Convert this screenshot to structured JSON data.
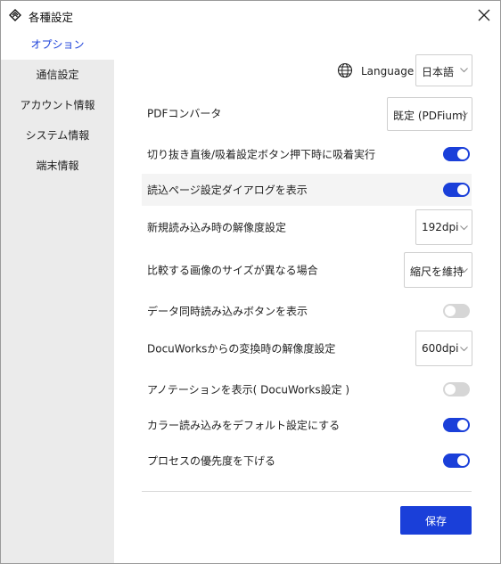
{
  "window": {
    "title": "各種設定",
    "app_icon": "app-logo-icon",
    "close_icon": "close-icon"
  },
  "sidebar": {
    "items": [
      {
        "label": "オプション",
        "active": true
      },
      {
        "label": "通信設定",
        "active": false
      },
      {
        "label": "アカウント情報",
        "active": false
      },
      {
        "label": "システム情報",
        "active": false
      },
      {
        "label": "端末情報",
        "active": false
      }
    ]
  },
  "language": {
    "icon": "globe-icon",
    "label": "Language",
    "value": "日本語"
  },
  "settings": {
    "pdf_converter": {
      "label": "PDFコンバータ",
      "value": "既定 (PDFium)"
    },
    "auto_suction": {
      "label": "切り抜き直後/吸着設定ボタン押下時に吸着実行",
      "on": true
    },
    "show_read_page_dialog": {
      "label": "読込ページ設定ダイアログを表示",
      "on": true
    },
    "new_read_resolution": {
      "label": "新規読み込み時の解像度設定",
      "value": "192dpi"
    },
    "compare_size_mismatch": {
      "label": "比較する画像のサイズが異なる場合",
      "value": "縮尺を維持"
    },
    "show_simultaneous_read": {
      "label": "データ同時読み込みボタンを表示",
      "on": false
    },
    "docuworks_resolution": {
      "label": "DocuWorksからの変換時の解像度設定",
      "value": "600dpi"
    },
    "show_annotation": {
      "label": "アノテーションを表示( DocuWorks設定 )",
      "on": false
    },
    "color_read_default": {
      "label": "カラー読み込みをデフォルト設定にする",
      "on": true
    },
    "lower_priority": {
      "label": "プロセスの優先度を下げる",
      "on": true
    }
  },
  "footer": {
    "save_label": "保存"
  },
  "colors": {
    "accent": "#1a3fd9",
    "sidebar_bg": "#ebebeb",
    "toggle_off": "#d6d6d6"
  }
}
